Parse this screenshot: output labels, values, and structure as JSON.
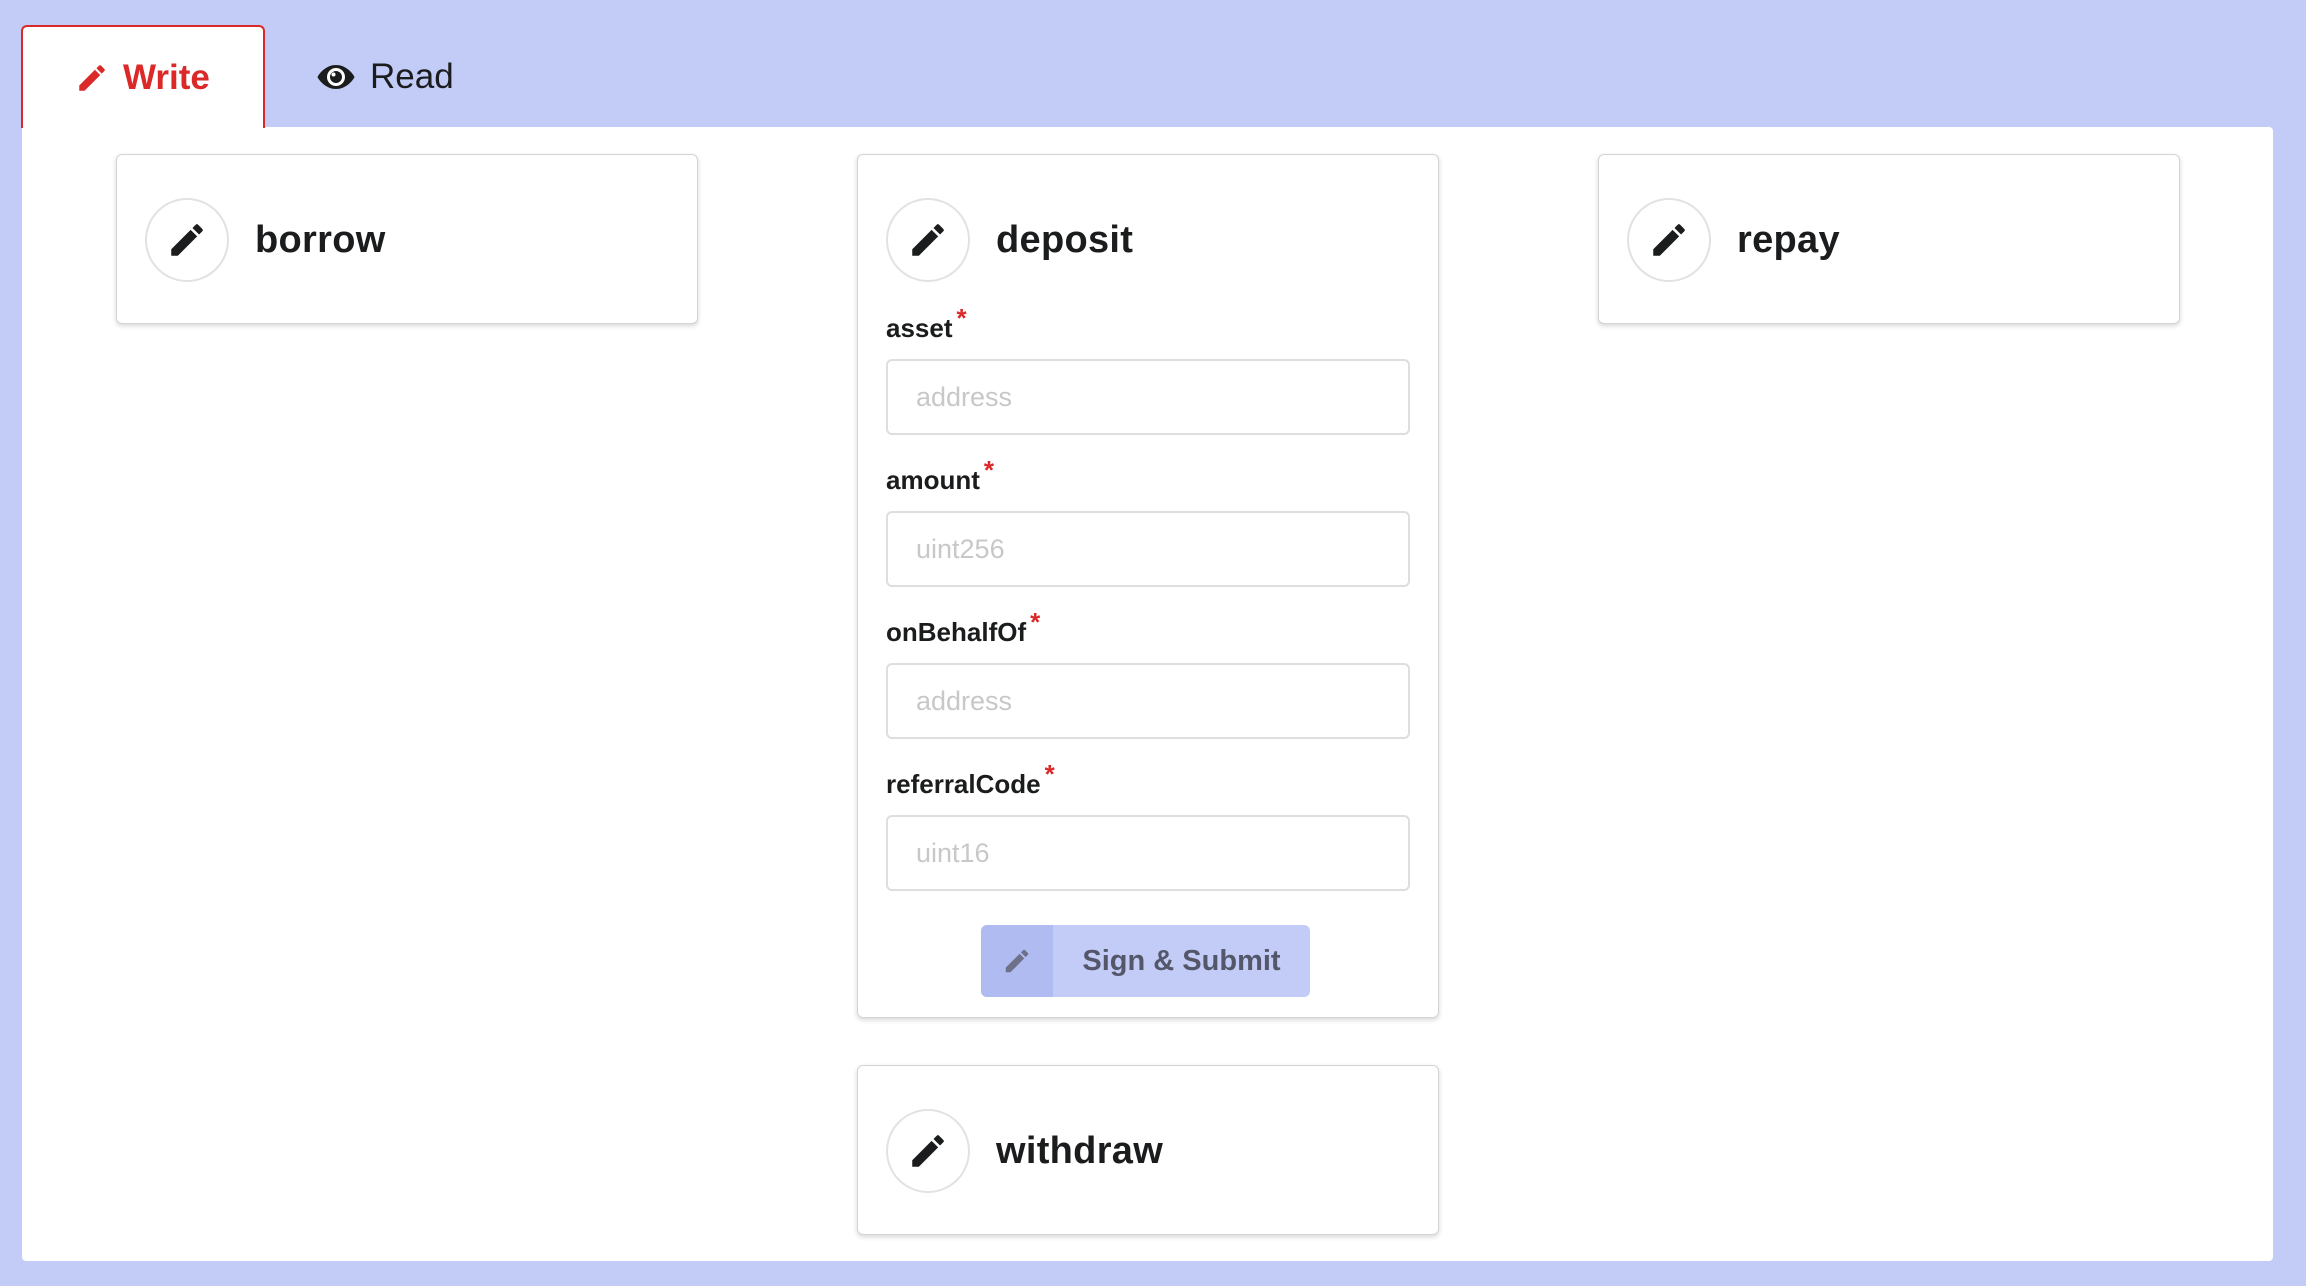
{
  "tabs": {
    "write_label": "Write",
    "read_label": "Read"
  },
  "functions": [
    {
      "name": "borrow",
      "expanded": false
    },
    {
      "name": "deposit",
      "expanded": true,
      "fields": [
        {
          "label": "asset",
          "required": "*",
          "placeholder": "address",
          "value": ""
        },
        {
          "label": "amount",
          "required": "*",
          "placeholder": "uint256",
          "value": ""
        },
        {
          "label": "onBehalfOf",
          "required": "*",
          "placeholder": "address",
          "value": ""
        },
        {
          "label": "referralCode",
          "required": "*",
          "placeholder": "uint16",
          "value": ""
        }
      ],
      "submit_label": "Sign & Submit"
    },
    {
      "name": "repay",
      "expanded": false
    },
    {
      "name": "withdraw",
      "expanded": false
    }
  ],
  "colors": {
    "page_background": "#c3cbf7",
    "active_tab_accent": "#db2828",
    "submit_button": "#c3cbf7",
    "required_marker": "#db2828"
  },
  "icons": {
    "write_tab": "pencil-icon",
    "read_tab": "eye-icon",
    "function": "pencil-icon",
    "submit": "pencil-icon"
  }
}
